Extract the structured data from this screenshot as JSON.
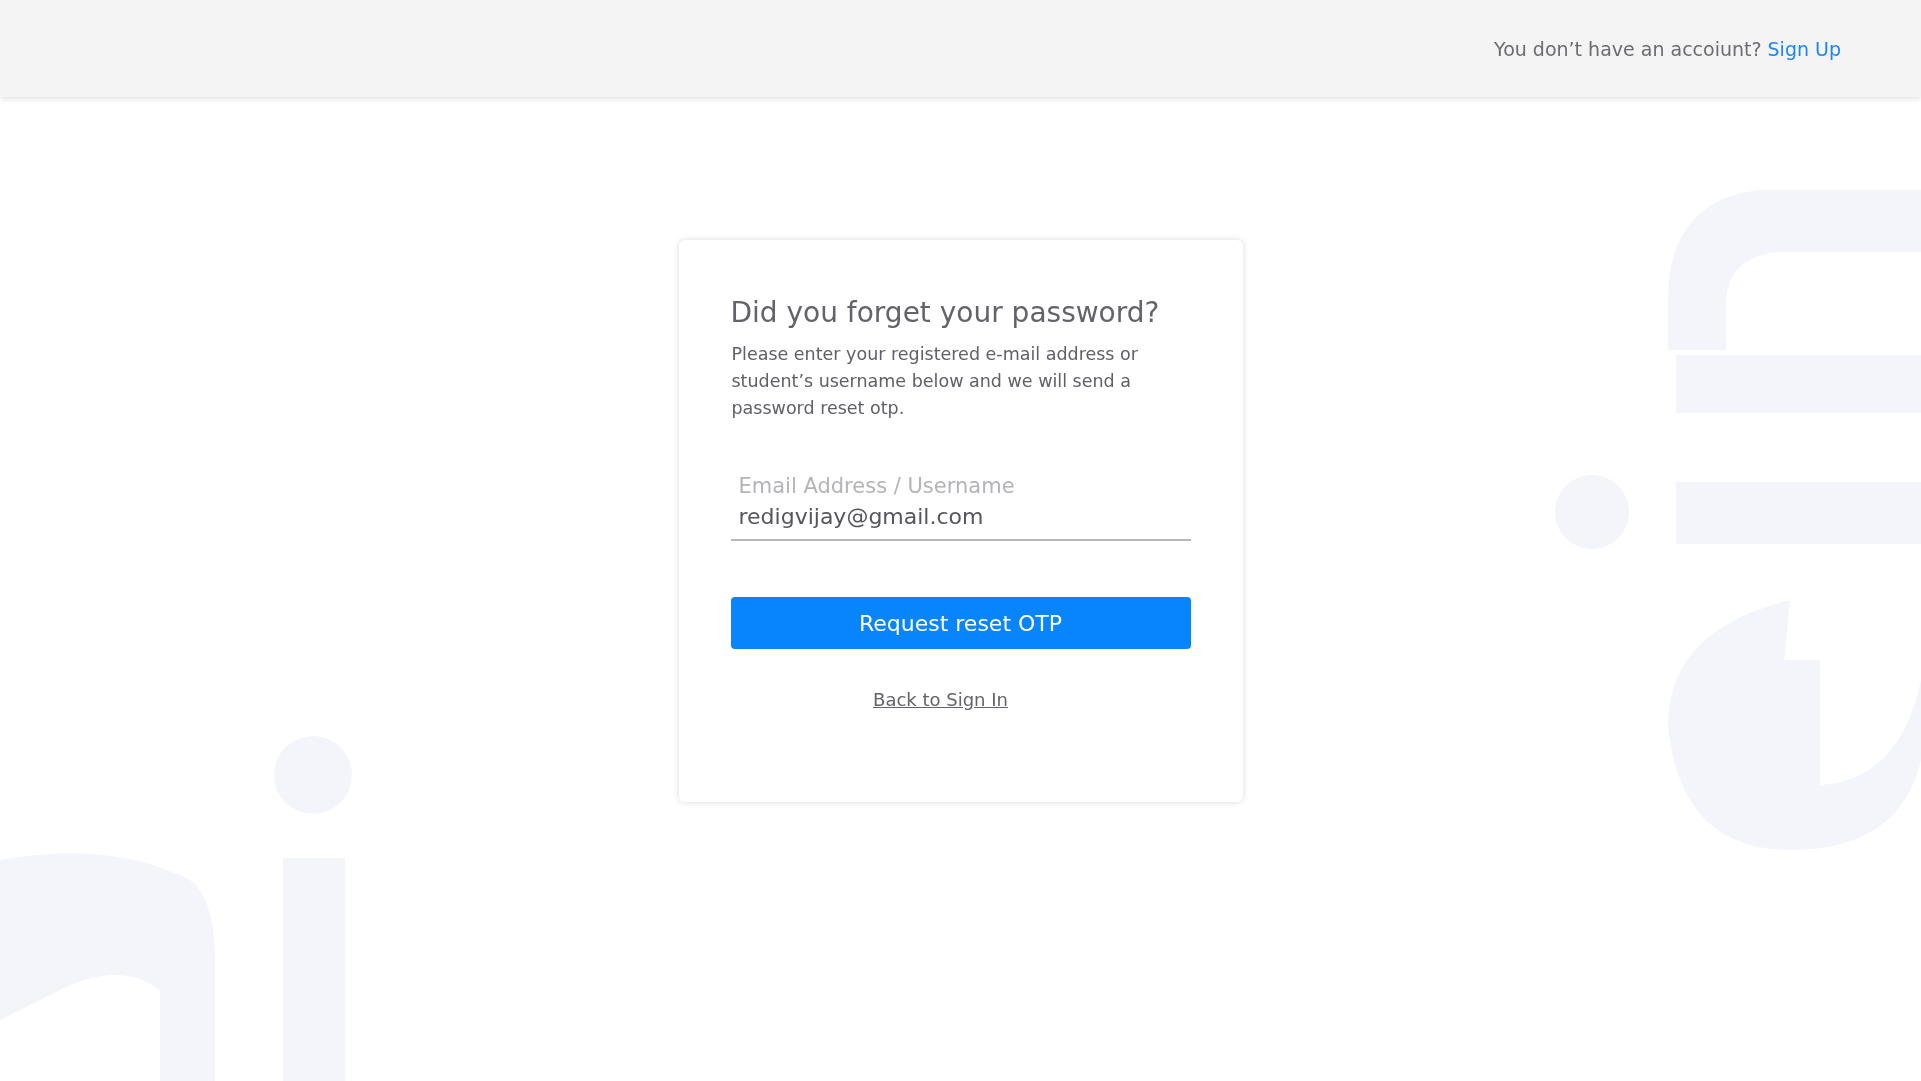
{
  "header": {
    "prompt": "You don’t have an accoiunt?",
    "link": "Sign Up"
  },
  "card": {
    "title": "Did you forget your password?",
    "description": "Please enter your registered e-mail address or student’s username below and we will send a password reset otp.",
    "field": {
      "label": "Email Address / Username",
      "value": "redigvijay@gmail.com"
    },
    "button": "Request reset OTP",
    "back_link": "Back to Sign In"
  }
}
